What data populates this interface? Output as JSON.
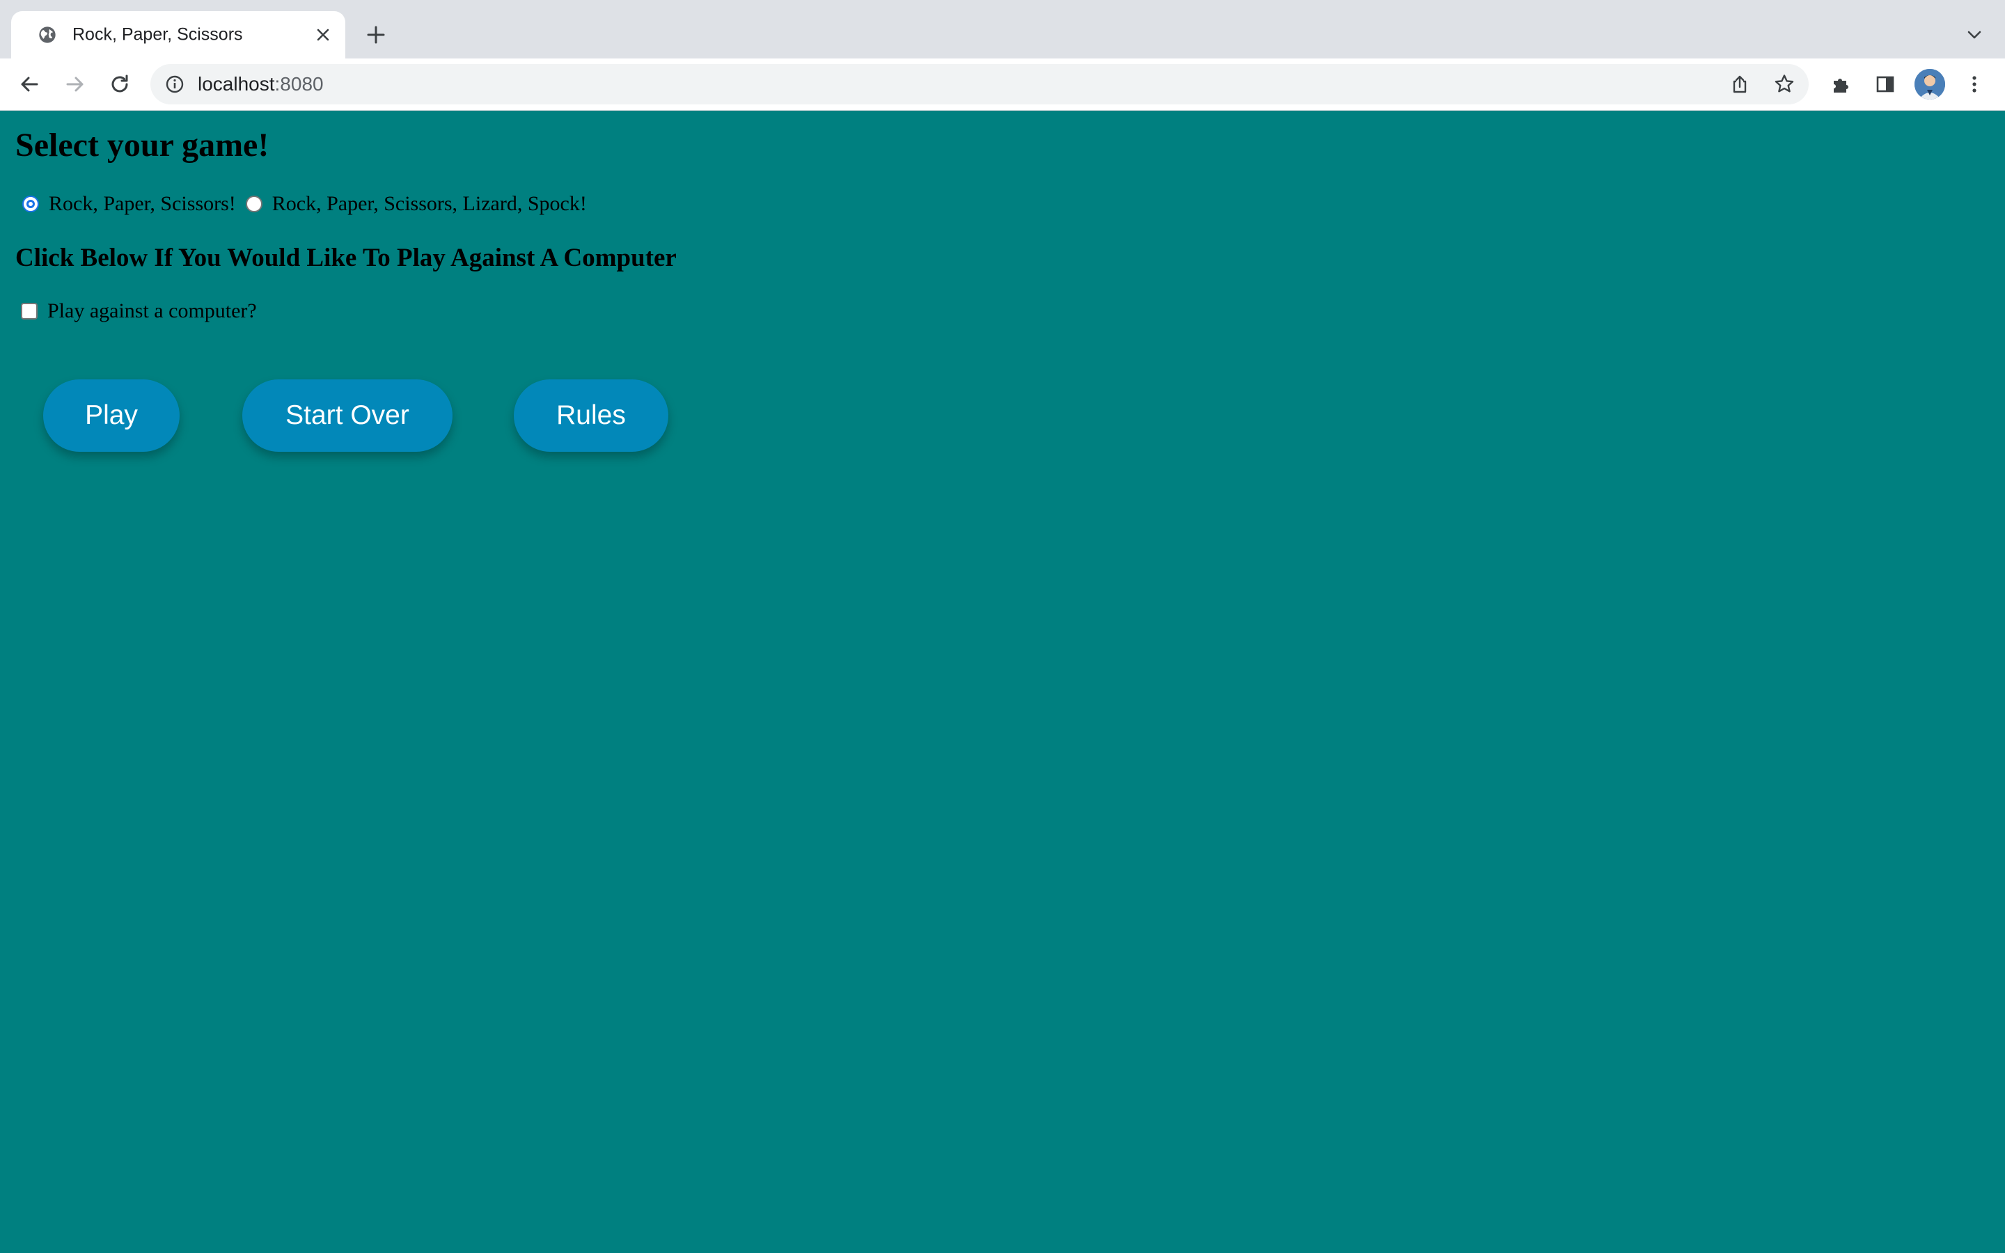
{
  "browser": {
    "tab": {
      "title": "Rock, Paper, Scissors"
    },
    "url": {
      "host": "localhost",
      "port": ":8080"
    },
    "icons": {
      "favicon": "globe-icon",
      "close": "close-icon",
      "new_tab": "plus-icon",
      "tab_search": "chevron-down-icon",
      "back": "back-arrow-icon",
      "forward": "forward-arrow-icon",
      "reload": "reload-icon",
      "info": "info-icon",
      "share": "share-icon",
      "bookmark": "star-icon",
      "extensions": "puzzle-icon",
      "side_panel": "side-panel-icon",
      "menu": "kebab-menu-icon"
    }
  },
  "page": {
    "background_color": "#008080",
    "button_color": "#0288b9",
    "heading": "Select your game!",
    "game_options": [
      {
        "label": "Rock, Paper, Scissors!",
        "checked": true
      },
      {
        "label": "Rock, Paper, Scissors, Lizard, Spock!",
        "checked": false
      }
    ],
    "computer_heading": "Click Below If You Would Like To Play Against A Computer",
    "computer_checkbox": {
      "label": "Play against a computer?",
      "checked": false
    },
    "buttons": {
      "play": "Play",
      "start_over": "Start Over",
      "rules": "Rules"
    }
  }
}
